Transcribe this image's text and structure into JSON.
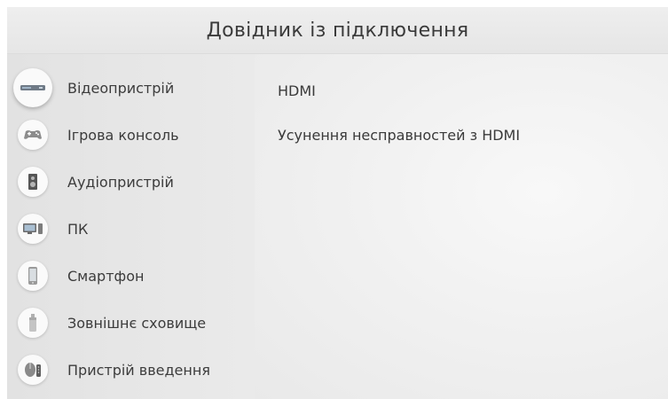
{
  "header": {
    "title": "Довідник із підключення"
  },
  "sidebar": {
    "items": [
      {
        "label": "Відеопристрій",
        "icon": "video-device-icon",
        "selected": true
      },
      {
        "label": "Ігрова консоль",
        "icon": "game-console-icon",
        "selected": false
      },
      {
        "label": "Аудіопристрій",
        "icon": "audio-device-icon",
        "selected": false
      },
      {
        "label": "ПК",
        "icon": "pc-icon",
        "selected": false
      },
      {
        "label": "Смартфон",
        "icon": "smartphone-icon",
        "selected": false
      },
      {
        "label": "Зовнішнє сховище",
        "icon": "external-storage-icon",
        "selected": false
      },
      {
        "label": "Пристрій введення",
        "icon": "input-device-icon",
        "selected": false
      }
    ]
  },
  "main": {
    "items": [
      {
        "label": "HDMI"
      },
      {
        "label": "Усунення несправностей з HDMI"
      }
    ]
  },
  "colors": {
    "background": "#ebebeb",
    "sidebar": "#e4e4e4",
    "text": "#3a3a3a"
  }
}
